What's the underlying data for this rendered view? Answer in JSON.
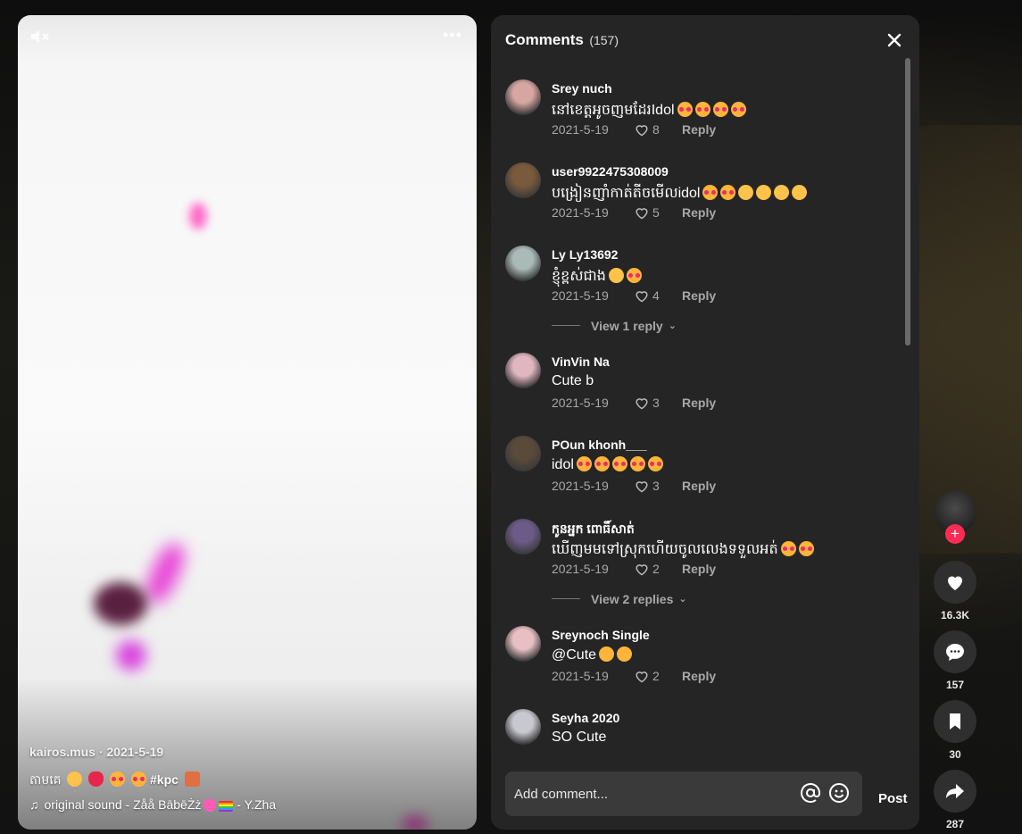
{
  "video": {
    "author": "kairos.mus",
    "date": "2021-5-19",
    "caption_text": "តាមគេ",
    "caption_tag": "#kpc",
    "sound_prefix": "original sound - ",
    "sound_name": "Zåå BābēŻż",
    "sound_suffix": " - Y.Zha"
  },
  "comments_panel": {
    "title": "Comments",
    "count": "(157)",
    "comments": [
      {
        "username": "Srey nuch",
        "text": "នៅខេត្តអូចញមដែរIdol",
        "emojis": [
          "hearts",
          "hearts",
          "hearts",
          "hearts"
        ],
        "date": "2021-5-19",
        "likes": "8",
        "reply": "Reply",
        "avatar_color": "#d8a6a0"
      },
      {
        "username": "user9922475308009",
        "text": "បង្រៀនញាំកាត់តីចមើលidol",
        "emojis": [
          "hearts",
          "hearts",
          "plead",
          "plead",
          "plead",
          "grin"
        ],
        "date": "2021-5-19",
        "likes": "5",
        "reply": "Reply",
        "avatar_color": "#7a5a3c"
      },
      {
        "username": "Ly Ly13692",
        "text": "ខ្ញុំខ្ពស់ជាង",
        "emojis": [
          "grin",
          "hearts"
        ],
        "date": "2021-5-19",
        "likes": "4",
        "reply": "Reply",
        "avatar_color": "#aabbb7"
      },
      {
        "username": "VinVin Na",
        "text": "Cute b",
        "emojis": [],
        "date": "2021-5-19",
        "likes": "3",
        "reply": "Reply",
        "avatar_color": "#e0b6c0"
      },
      {
        "username": "POun khonh___",
        "text": "idol",
        "emojis": [
          "hearts",
          "hearts",
          "hearts",
          "hearts",
          "hearts"
        ],
        "date": "2021-5-19",
        "likes": "3",
        "reply": "Reply",
        "avatar_color": "#5a4a3a"
      },
      {
        "username": "កូនអ្នក ពោធិ៍សាត់",
        "text": "ឃើញមមទៅស្រុកហើយចូលលេងទទួលអត់",
        "emojis": [
          "hearts",
          "hearts"
        ],
        "date": "2021-5-19",
        "likes": "2",
        "reply": "Reply",
        "avatar_color": "#6c5a88"
      },
      {
        "username": "Sreynoch Single",
        "text": "@Cute",
        "emojis": [
          "heart-eyes",
          "heart-eyes"
        ],
        "date": "2021-5-19",
        "likes": "2",
        "reply": "Reply",
        "avatar_color": "#e8c0c4"
      },
      {
        "username": "Seyha 2020",
        "text": "SO Cute",
        "emojis": [],
        "date": "",
        "likes": "",
        "reply": "",
        "avatar_color": "#c8c8d0"
      }
    ],
    "view_replies": [
      "View 1 reply",
      "View 2 replies"
    ],
    "input_placeholder": "Add comment...",
    "post_label": "Post"
  },
  "actions": {
    "likes": "16.3K",
    "comments": "157",
    "saves": "30",
    "shares": "287"
  },
  "colors": {
    "panel_bg": "#252525",
    "accent": "#fe2c55",
    "muted_text": "#a8a8a8"
  }
}
